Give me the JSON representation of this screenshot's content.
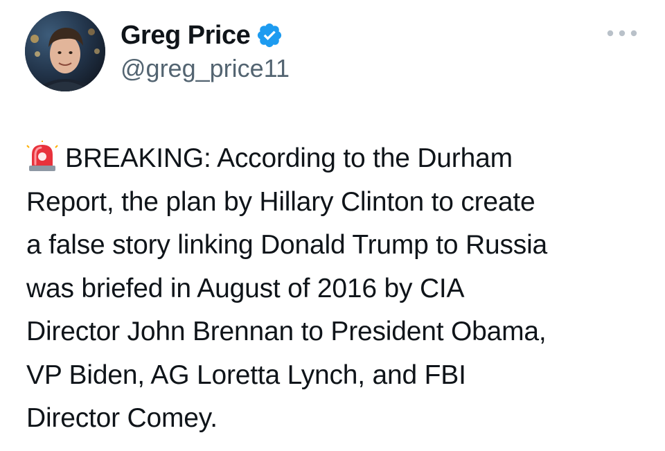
{
  "author": {
    "display_name": "Greg Price",
    "handle": "@greg_price11",
    "verified": true,
    "avatar_icon": "avatar-photo",
    "verified_icon": "verified-badge-icon"
  },
  "menu": {
    "icon": "more-options-icon"
  },
  "tweet": {
    "leading_icon": "siren-emoji-icon",
    "lines": [
      "BREAKING: According to the Durham",
      "Report, the plan by Hillary Clinton to create",
      "a false story linking Donald Trump to Russia",
      "was briefed in August of 2016 by CIA",
      "Director John Brennan to President Obama,",
      "VP Biden, AG Loretta Lynch, and FBI",
      "Director Comey."
    ]
  },
  "colors": {
    "text": "#0f1419",
    "secondary_text": "#536471",
    "verified_blue": "#1d9bf0",
    "siren_red": "#e8323c"
  }
}
